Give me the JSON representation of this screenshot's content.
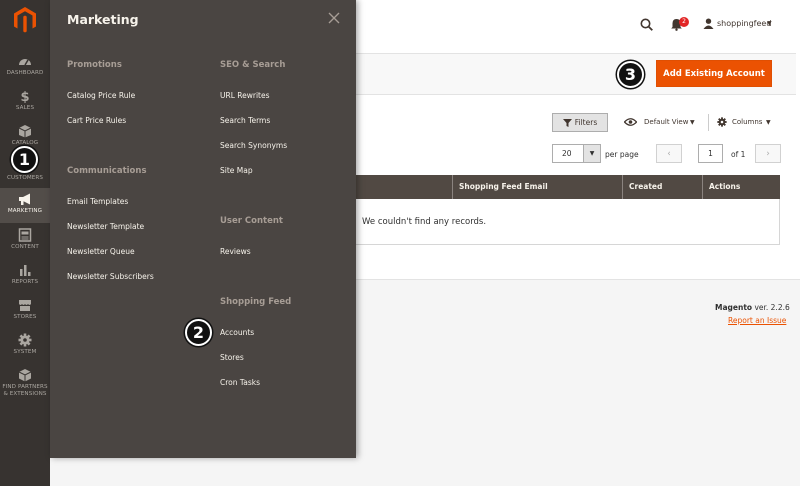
{
  "sidebar": {
    "items": [
      {
        "label": "DASHBOARD",
        "icon": "dashboard-icon"
      },
      {
        "label": "SALES",
        "icon": "dollar-icon"
      },
      {
        "label": "CATALOG",
        "icon": "box-icon"
      },
      {
        "label": "CUSTOMERS",
        "icon": "person-icon"
      },
      {
        "label": "MARKETING",
        "icon": "megaphone-icon"
      },
      {
        "label": "CONTENT",
        "icon": "content-icon"
      },
      {
        "label": "REPORTS",
        "icon": "bar-chart-icon"
      },
      {
        "label": "STORES",
        "icon": "store-icon"
      },
      {
        "label": "SYSTEM",
        "icon": "gear-icon"
      },
      {
        "label": "FIND PARTNERS",
        "label2": "& EXTENSIONS",
        "icon": "cube-icon"
      }
    ]
  },
  "header": {
    "user": "shoppingfeed",
    "notifications_count": "2"
  },
  "actions": {
    "add_existing_account": "Add Existing Account"
  },
  "callouts": {
    "one": "1",
    "two": "2",
    "three": "3"
  },
  "toolbar": {
    "filters": "Filters",
    "default_view": "Default View",
    "columns": "Columns",
    "per_page_value": "20",
    "per_page_label": "per page",
    "page_value": "1",
    "of_pages": "of 1"
  },
  "grid": {
    "columns": [
      "Shopping Feed Email",
      "Created",
      "Actions"
    ],
    "empty_message": "We couldn't find any records."
  },
  "footer": {
    "brand": "Magento",
    "version": " ver. 2.2.6",
    "report_issue": "Report an Issue"
  },
  "flyout": {
    "title": "Marketing",
    "left": [
      {
        "title": "Promotions",
        "links": [
          "Catalog Price Rule",
          "Cart Price Rules"
        ]
      },
      {
        "title": "Communications",
        "links": [
          "Email Templates",
          "Newsletter Template",
          "Newsletter Queue",
          "Newsletter Subscribers"
        ]
      }
    ],
    "right": [
      {
        "title": "SEO & Search",
        "links": [
          "URL Rewrites",
          "Search Terms",
          "Search Synonyms",
          "Site Map"
        ]
      },
      {
        "title": "User Content",
        "links": [
          "Reviews"
        ]
      },
      {
        "title": "Shopping Feed",
        "links": [
          "Accounts",
          "Stores",
          "Cron Tasks"
        ]
      }
    ]
  },
  "colors": {
    "accent": "#eb5202",
    "sidebar": "#373330",
    "flyout": "#4a4542",
    "grid_header": "#514943"
  }
}
